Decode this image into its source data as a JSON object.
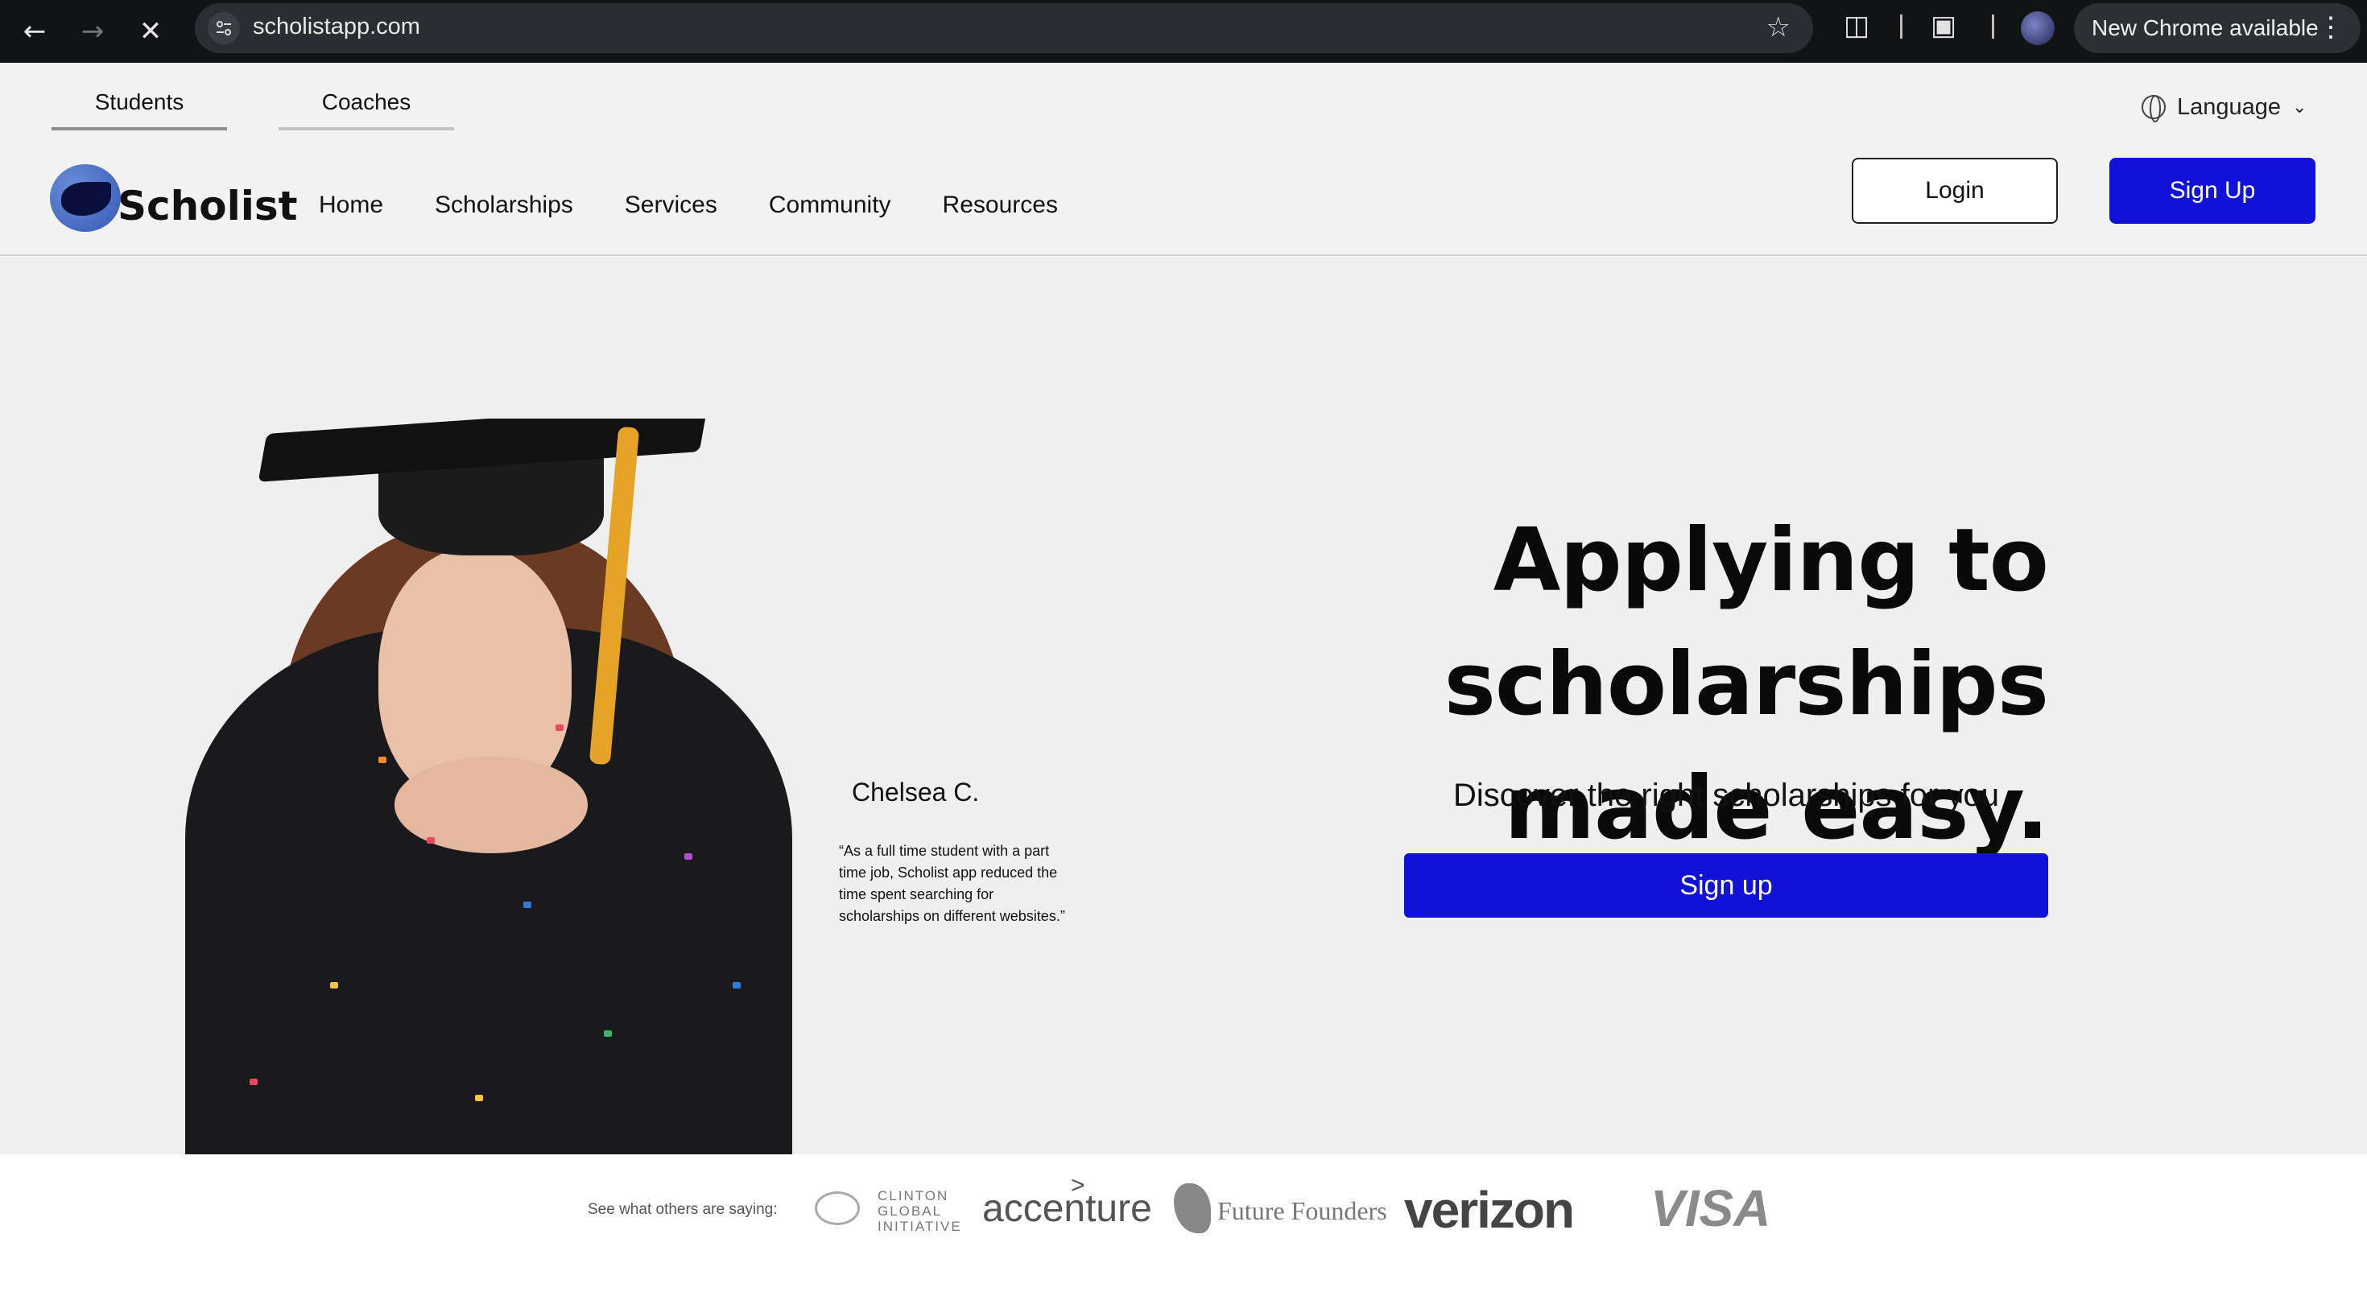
{
  "browser": {
    "url": "scholistapp.com",
    "update_label": "New Chrome available"
  },
  "audience_tabs": [
    {
      "label": "Students",
      "active": true
    },
    {
      "label": "Coaches",
      "active": false
    }
  ],
  "language": {
    "label": "Language"
  },
  "brand": {
    "name": "Scholist",
    "primary_color": "#1111d8"
  },
  "nav": {
    "items": [
      "Home",
      "Scholarships",
      "Services",
      "Community",
      "Resources"
    ]
  },
  "auth": {
    "login_label": "Login",
    "signup_label": "Sign Up"
  },
  "hero": {
    "headline_line1": "Applying to scholarships",
    "headline_line2": "made easy.",
    "subheadline": "Discover the right scholarships for you",
    "cta_label": "Sign up",
    "testimonial": {
      "name": "Chelsea C.",
      "quote": "“As a full time student with a part time job, Scholist app reduced the time spent searching for scholarships on different websites.”"
    }
  },
  "partners": {
    "label": "See what others are saying:",
    "logos": [
      "CLINTON GLOBAL INITIATIVE",
      "accenture",
      "Future Founders",
      "verizon",
      "VISA"
    ]
  }
}
